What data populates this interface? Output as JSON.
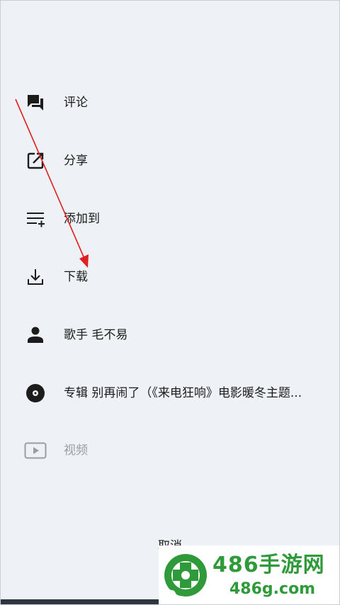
{
  "menu": {
    "items": [
      {
        "label": "评论",
        "icon": "comment-icon",
        "enabled": true
      },
      {
        "label": "分享",
        "icon": "share-icon",
        "enabled": true
      },
      {
        "label": "添加到",
        "icon": "add-to-playlist-icon",
        "enabled": true
      },
      {
        "label": "下载",
        "icon": "download-icon",
        "enabled": true
      },
      {
        "label": "歌手 毛不易",
        "icon": "person-icon",
        "enabled": true
      },
      {
        "label": "专辑 别再闹了（《来电狂响》电影暖冬主题...",
        "icon": "album-disc-icon",
        "enabled": true
      },
      {
        "label": "视频",
        "icon": "video-play-icon",
        "enabled": false
      }
    ]
  },
  "cancel_label": "取消",
  "annotation_color": "#e02020",
  "watermark": {
    "title": "486手游网",
    "domain": "486g.com",
    "color": "#2f9a3a"
  }
}
